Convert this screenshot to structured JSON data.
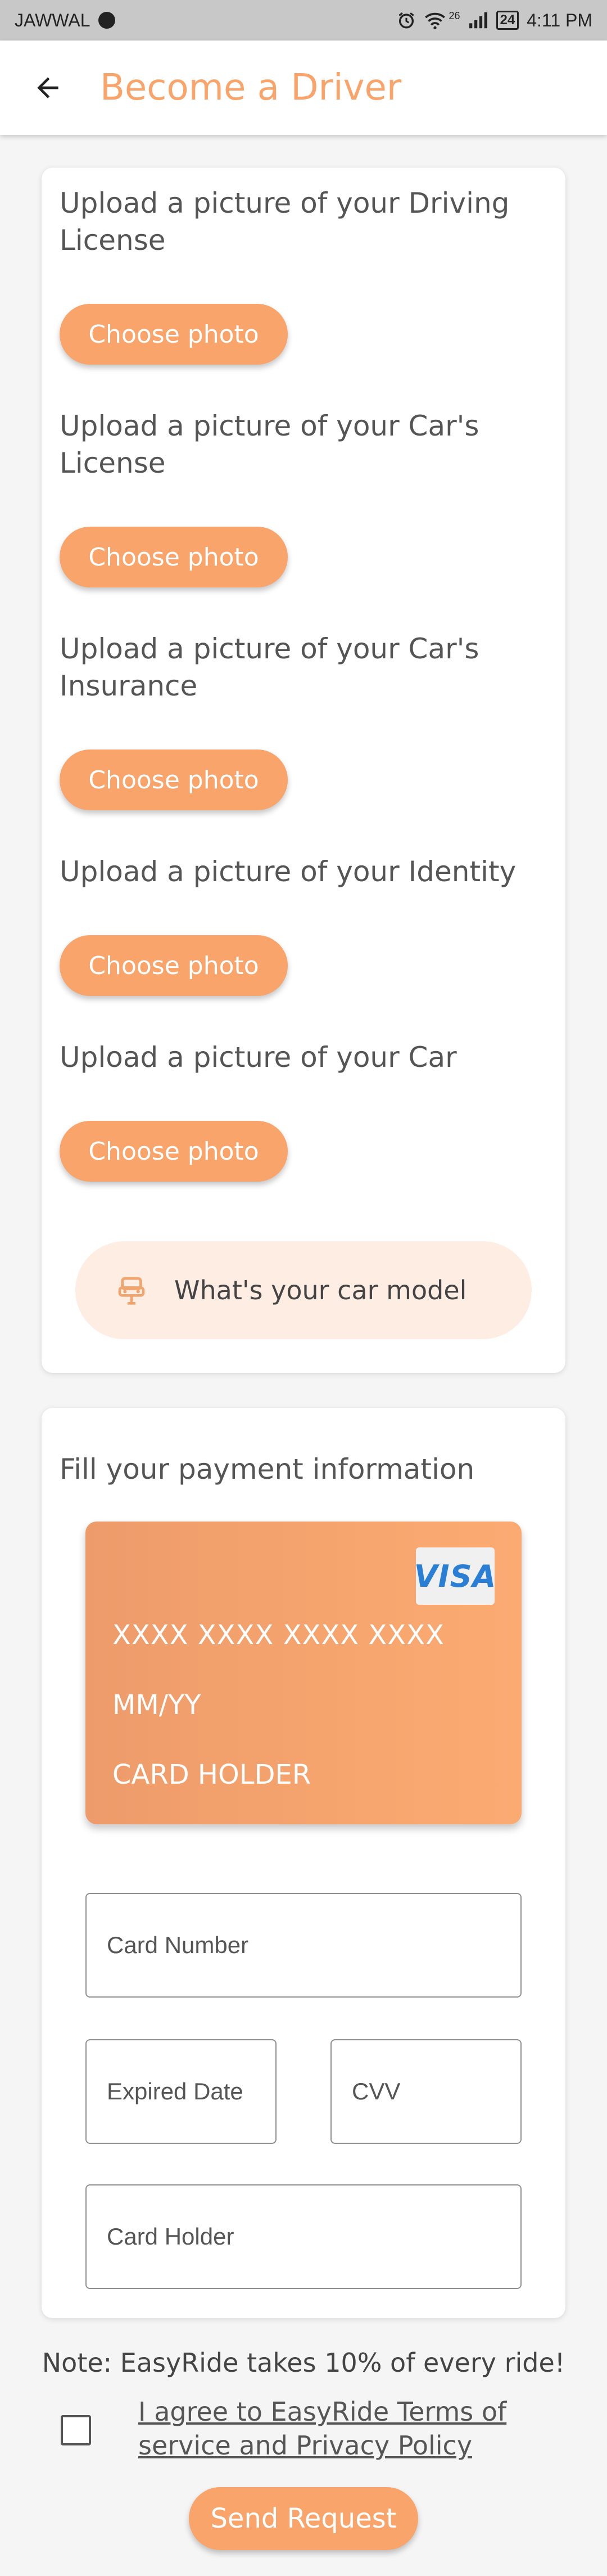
{
  "status_bar": {
    "carrier": "JAWWAL",
    "network": "26",
    "battery": "24",
    "time": "4:11 PM"
  },
  "app_bar": {
    "title": "Become a Driver"
  },
  "uploads": [
    {
      "label": "Upload a picture of your Driving License",
      "button": "Choose photo"
    },
    {
      "label": "Upload a picture of your Car's License",
      "button": "Choose photo"
    },
    {
      "label": "Upload a picture of your Car's Insurance",
      "button": "Choose photo"
    },
    {
      "label": "Upload a picture of your Identity",
      "button": "Choose photo"
    },
    {
      "label": "Upload a picture of your Car",
      "button": "Choose photo"
    }
  ],
  "car_model": {
    "label": "What's your car model",
    "icon": "car-seat-icon"
  },
  "payment": {
    "title": "Fill your payment information",
    "card": {
      "brand": "VISA",
      "number": "XXXX XXXX XXXX XXXX",
      "expiry": "MM/YY",
      "holder": "CARD HOLDER"
    },
    "fields": {
      "card_number": "Card Number",
      "expired_date": "Expired Date",
      "cvv": "CVV",
      "card_holder": "Card Holder"
    }
  },
  "note": "Note: EasyRide takes 10% of every ride!",
  "agree": {
    "text": "I agree to EasyRide Terms of service and Privacy Policy",
    "checked": false
  },
  "submit": {
    "label": "Send Request"
  },
  "colors": {
    "accent": "#F8A46A",
    "accent_light": "#FEEDE2",
    "background": "#F5F5F5"
  }
}
